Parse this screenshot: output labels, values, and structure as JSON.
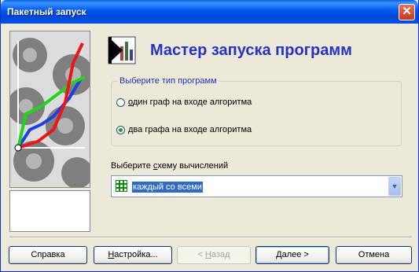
{
  "window": {
    "title": "Пакетный запуск",
    "close_glyph": "✕"
  },
  "wizard": {
    "heading": "Мастер запуска программ",
    "icon": "wizard-chart-icon"
  },
  "program_type": {
    "legend": "Выберите тип программ",
    "options": [
      {
        "prefix": "",
        "accel": "о",
        "rest": "дин граф на входе алгоритма",
        "selected": false
      },
      {
        "prefix": "",
        "accel": "д",
        "rest": "ва графа на входе алгоритма",
        "selected": true
      }
    ]
  },
  "scheme": {
    "label_prefix": "Выберите ",
    "label_accel": "с",
    "label_rest": "хему вычислений",
    "value": "каждый со всеми",
    "icon": "grid-icon",
    "arrow_glyph": "▼"
  },
  "buttons": {
    "help": "Справка",
    "settings_accel": "Н",
    "settings_rest": "астройка...",
    "back_prefix": "< ",
    "back_accel": "Н",
    "back_rest": "азад",
    "next": "Далее >",
    "cancel": "Отмена"
  }
}
